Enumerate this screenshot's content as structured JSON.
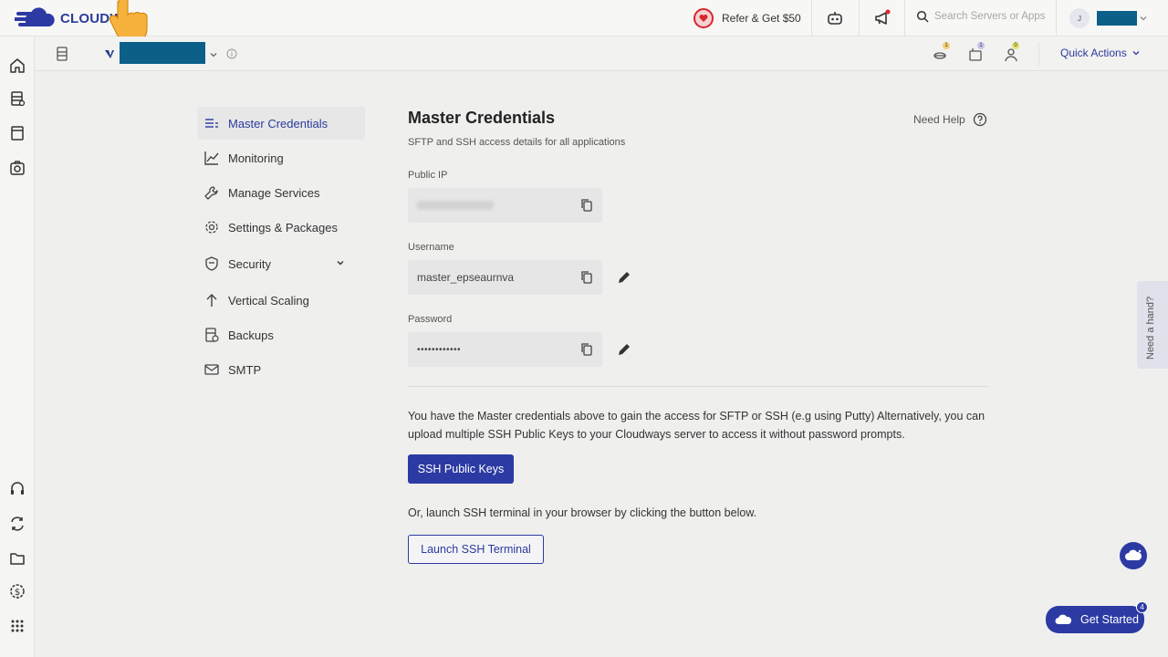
{
  "topbar": {
    "logo_text": "CLOUDW",
    "refer_label": "Refer & Get $50",
    "search_placeholder": "Search Servers or Apps",
    "user_initial": "J"
  },
  "subbar": {
    "quick_actions": "Quick Actions",
    "badges": [
      "1",
      "1",
      "0"
    ]
  },
  "nav": {
    "items": [
      {
        "label": "Master Credentials",
        "icon": "list-icon"
      },
      {
        "label": "Monitoring",
        "icon": "chart-icon"
      },
      {
        "label": "Manage Services",
        "icon": "wrench-icon"
      },
      {
        "label": "Settings & Packages",
        "icon": "gear-icon"
      },
      {
        "label": "Security",
        "icon": "shield-icon"
      },
      {
        "label": "Vertical Scaling",
        "icon": "arrow-up-icon"
      },
      {
        "label": "Backups",
        "icon": "backup-icon"
      },
      {
        "label": "SMTP",
        "icon": "mail-icon"
      }
    ]
  },
  "main": {
    "title": "Master Credentials",
    "subtitle": "SFTP and SSH access details for all applications",
    "need_help": "Need Help",
    "public_ip_label": "Public IP",
    "username_label": "Username",
    "username_value": "master_epseaurnva",
    "password_label": "Password",
    "password_value": "••••••••••••",
    "paragraph": "You have the Master credentials above to gain the access for SFTP or SSH (e.g using Putty) Alternatively, you can upload multiple SSH Public Keys to your Cloudways server to access it without password prompts.",
    "ssh_keys_button": "SSH Public Keys",
    "paragraph2": "Or, launch SSH terminal in your browser by clicking the button below.",
    "launch_button": "Launch SSH Terminal"
  },
  "widgets": {
    "need_a_hand": "Need a hand?",
    "get_started": "Get Started",
    "get_started_badge": "4"
  },
  "colors": {
    "accent": "#2c3aa3",
    "redact": "#0c5f88",
    "danger": "#d9262b"
  }
}
